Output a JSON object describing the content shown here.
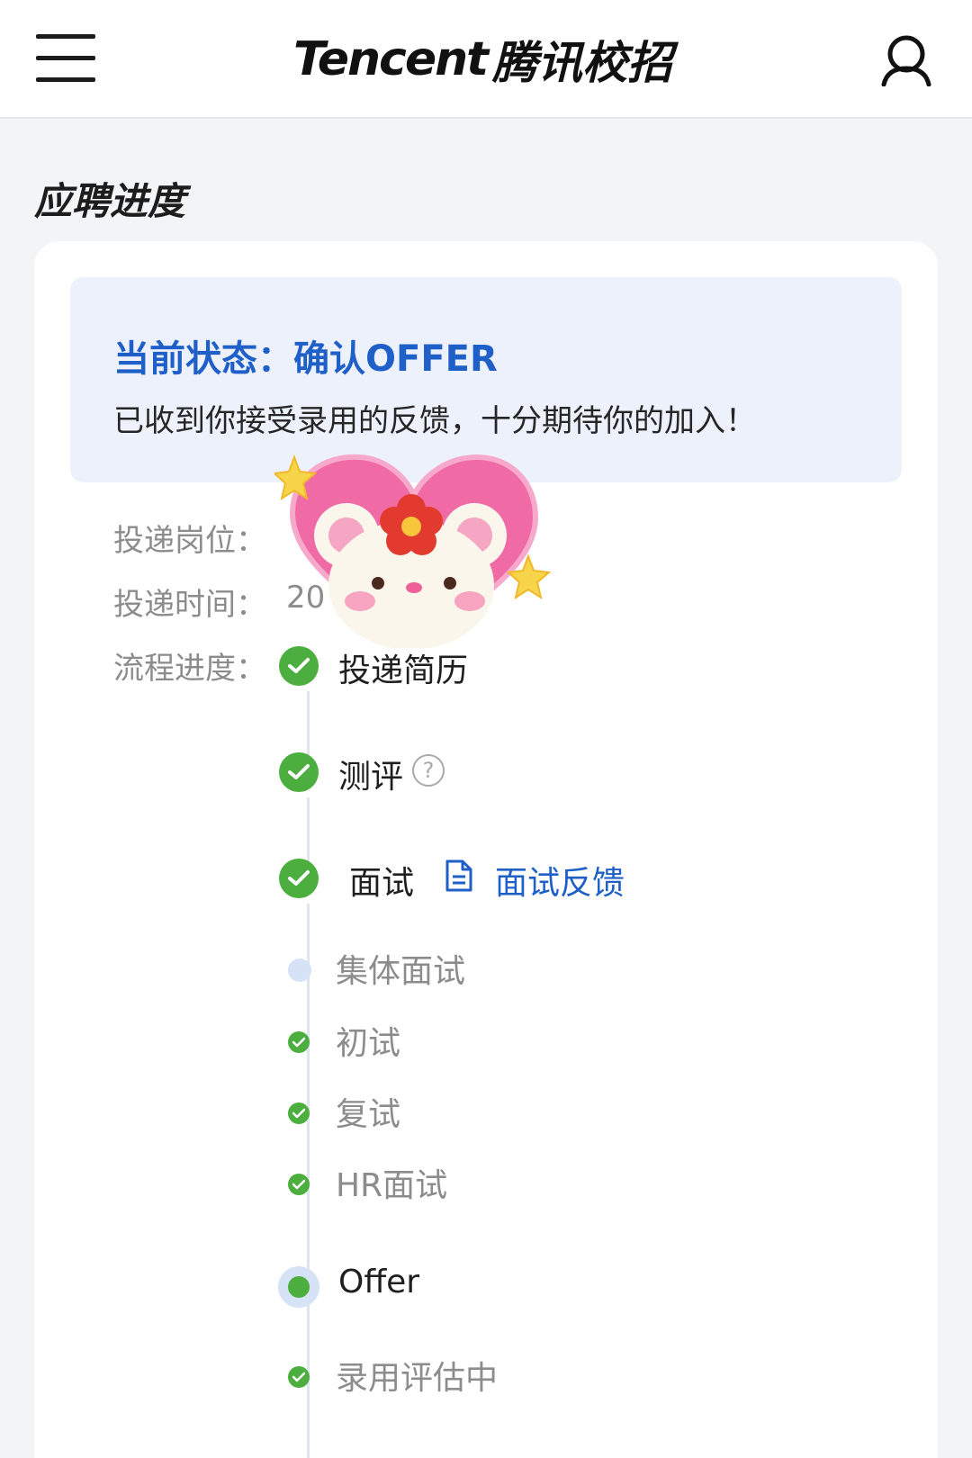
{
  "header": {
    "logo_en": "Tencent",
    "logo_cn": "腾讯校招",
    "menu_icon": "hamburger-menu-icon",
    "user_icon": "user-icon"
  },
  "page": {
    "title": "应聘进度"
  },
  "status": {
    "label": "当前状态：",
    "value": "确认OFFER",
    "description": "已收到你接受录用的反馈，十分期待你的加入！"
  },
  "info": {
    "position_label": "投递岗位：",
    "position_value": "",
    "time_label": "投递时间：",
    "time_value": "20",
    "progress_label": "流程进度："
  },
  "progress": {
    "steps": [
      {
        "label": "投递简历",
        "state": "done"
      },
      {
        "label": "测评",
        "state": "done",
        "has_help": true
      },
      {
        "label": "面试",
        "state": "done",
        "link": "面试反馈"
      },
      {
        "label": "集体面试",
        "state": "skipped",
        "sub": true
      },
      {
        "label": "初试",
        "state": "done",
        "sub": true
      },
      {
        "label": "复试",
        "state": "done",
        "sub": true
      },
      {
        "label": "HR面试",
        "state": "done",
        "sub": true
      },
      {
        "label": "Offer",
        "state": "current"
      },
      {
        "label": "录用评估中",
        "state": "done",
        "sub": true
      }
    ]
  },
  "colors": {
    "accent_blue": "#1f5fc8",
    "success_green": "#4cae3f",
    "status_bg": "#ecf1fb",
    "page_bg": "#f3f4f6"
  }
}
